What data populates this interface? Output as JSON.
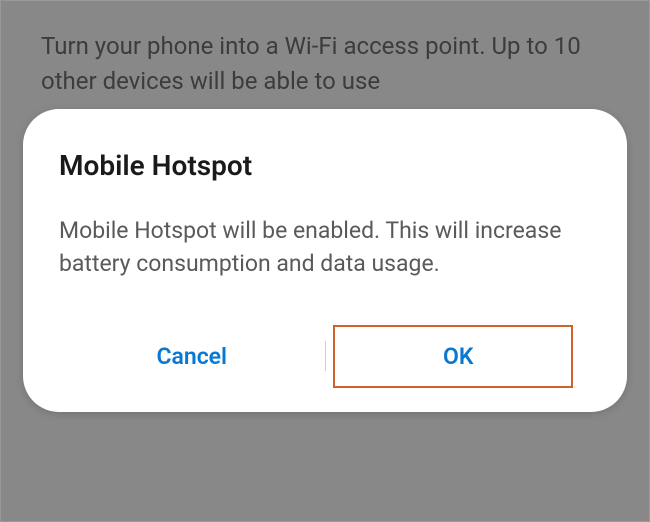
{
  "background": {
    "description": "Turn your phone into a Wi-Fi access point. Up to 10 other devices will be able to use"
  },
  "dialog": {
    "title": "Mobile Hotspot",
    "message": "Mobile Hotspot will be enabled. This will increase battery consumption and data usage.",
    "cancel_label": "Cancel",
    "ok_label": "OK"
  }
}
